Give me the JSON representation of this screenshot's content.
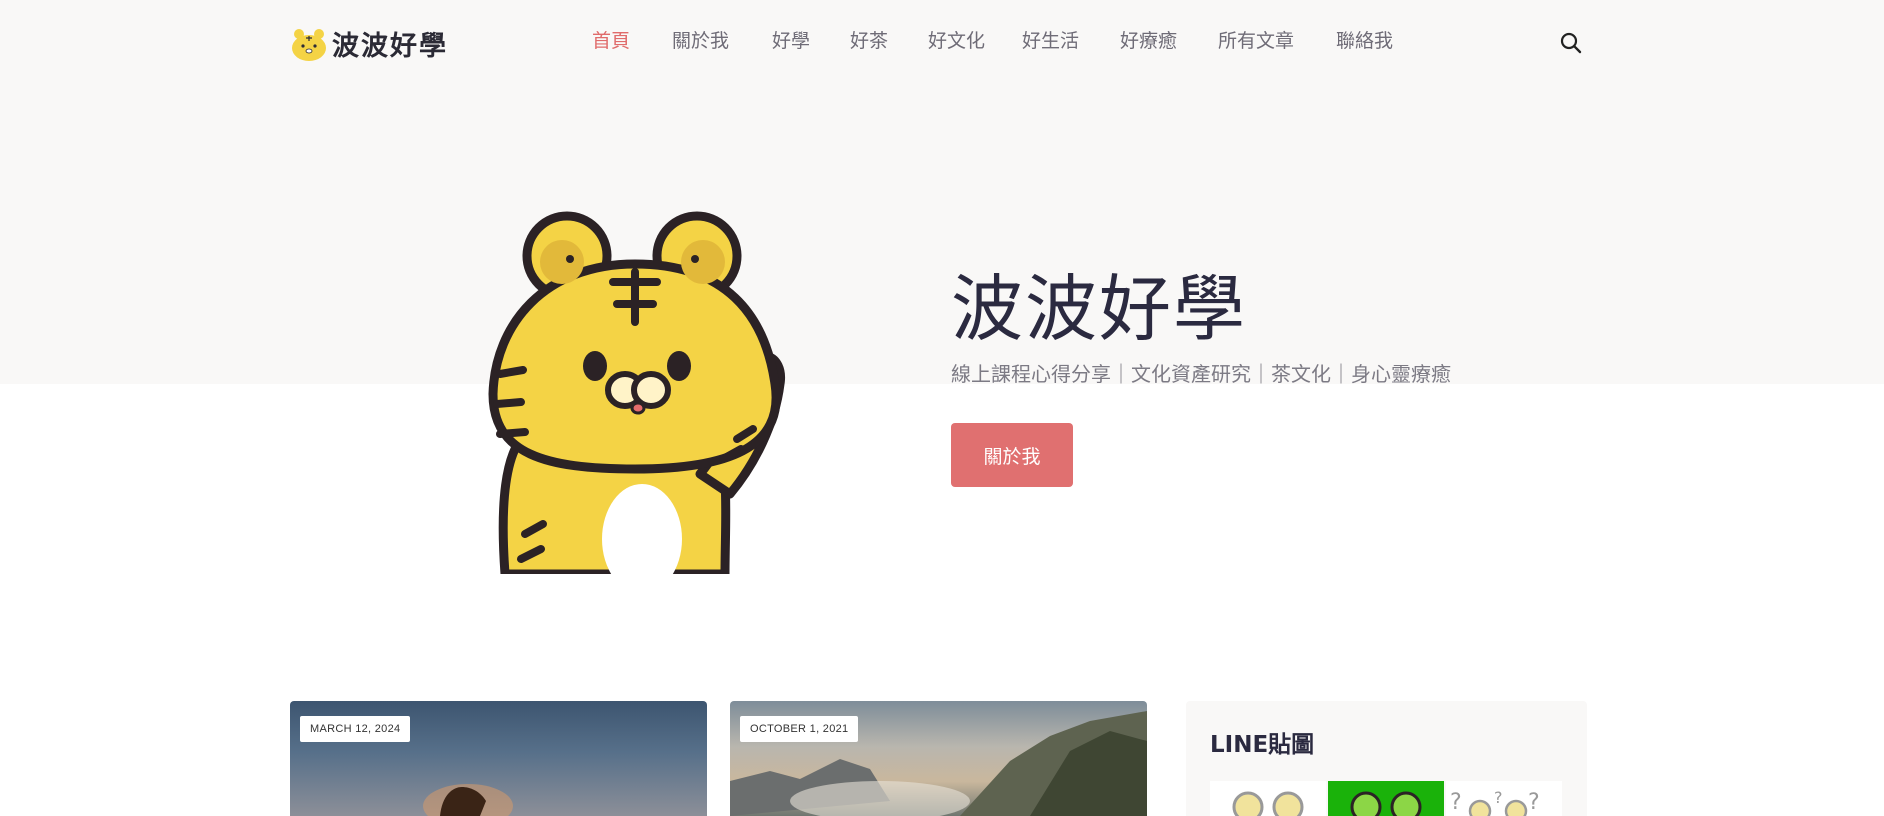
{
  "header": {
    "logo_text": "波波好學",
    "nav": [
      {
        "label": "首頁",
        "active": true
      },
      {
        "label": "關於我"
      },
      {
        "label": "好學"
      },
      {
        "label": "好茶"
      },
      {
        "label": "好文化"
      },
      {
        "label": "好生活"
      },
      {
        "label": "好療癒"
      },
      {
        "label": "所有文章"
      },
      {
        "label": "聯絡我"
      }
    ],
    "search_icon": "search-icon"
  },
  "hero": {
    "title": "波波好學",
    "subtitle": "線上課程心得分享｜文化資產研究｜茶文化｜身心靈療癒",
    "button_label": "關於我"
  },
  "posts": [
    {
      "date": "MARCH 12, 2024"
    },
    {
      "date": "OCTOBER 1, 2021"
    }
  ],
  "sidebar": {
    "widget_title": "LINE貼圖"
  },
  "colors": {
    "accent": "#e07070",
    "hero_bg": "#f9f8f7",
    "tiger_yellow": "#f4d345",
    "line_green": "#1ab20a"
  }
}
